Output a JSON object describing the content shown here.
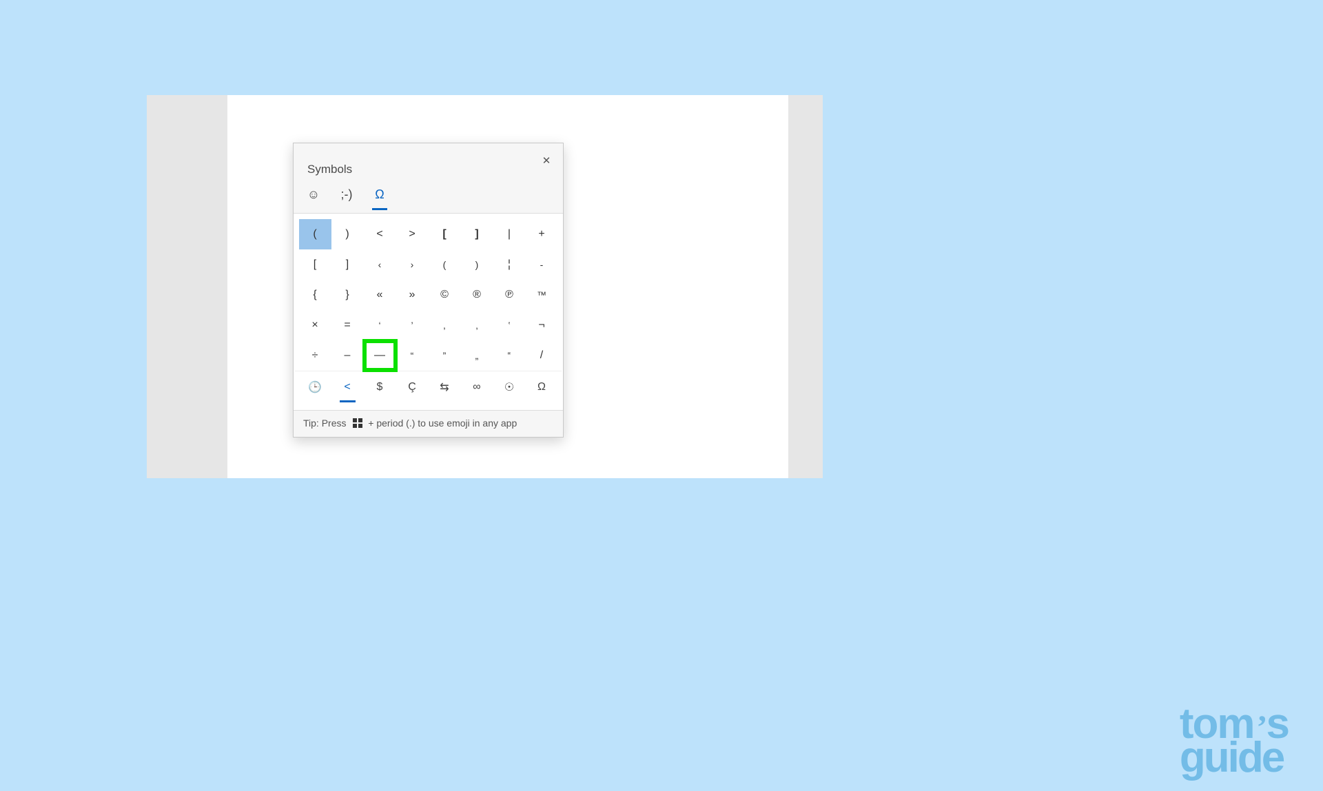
{
  "page_background": "#bde2fb",
  "panel": {
    "title": "Symbols",
    "close_glyph": "✕",
    "tabs": [
      {
        "id": "emoji",
        "glyph": "☺",
        "active": false,
        "name": "tab-emoji"
      },
      {
        "id": "kaomoji",
        "glyph": ";-)",
        "active": false,
        "name": "tab-kaomoji"
      },
      {
        "id": "symbols",
        "glyph": "Ω",
        "active": true,
        "name": "tab-symbols"
      }
    ],
    "grid": [
      [
        {
          "g": "(",
          "state": "selected"
        },
        {
          "g": ")"
        },
        {
          "g": "<"
        },
        {
          "g": ">"
        },
        {
          "g": "[",
          "b": true
        },
        {
          "g": "]",
          "b": true
        },
        {
          "g": "|"
        },
        {
          "g": "+"
        }
      ],
      [
        {
          "g": "["
        },
        {
          "g": "]"
        },
        {
          "g": "‹",
          "sm": true
        },
        {
          "g": "›",
          "sm": true
        },
        {
          "g": "(",
          "sm": true
        },
        {
          "g": ")",
          "sm": true
        },
        {
          "g": "¦"
        },
        {
          "g": "-",
          "sm": true
        }
      ],
      [
        {
          "g": "{"
        },
        {
          "g": "}"
        },
        {
          "g": "«"
        },
        {
          "g": "»"
        },
        {
          "g": "©"
        },
        {
          "g": "®"
        },
        {
          "g": "℗"
        },
        {
          "g": "™",
          "sm": true
        }
      ],
      [
        {
          "g": "×"
        },
        {
          "g": "="
        },
        {
          "g": "‘",
          "sm": true
        },
        {
          "g": "’",
          "sm": true
        },
        {
          "g": ",",
          "sm": true
        },
        {
          "g": "‚",
          "sm": true
        },
        {
          "g": "‛",
          "sm": true
        },
        {
          "g": "¬"
        }
      ],
      [
        {
          "g": "÷"
        },
        {
          "g": "–"
        },
        {
          "g": "—",
          "state": "highlight"
        },
        {
          "g": "“",
          "sm": true
        },
        {
          "g": "”",
          "sm": true
        },
        {
          "g": "„",
          "sm": true
        },
        {
          "g": "‟",
          "sm": true
        },
        {
          "g": "/"
        }
      ]
    ],
    "categories": [
      {
        "glyph": "🕒",
        "name": "cat-recent",
        "active": false
      },
      {
        "glyph": "<",
        "name": "cat-punctuation",
        "active": true
      },
      {
        "glyph": "$",
        "name": "cat-currency",
        "active": false
      },
      {
        "glyph": "Ç",
        "name": "cat-latin",
        "active": false
      },
      {
        "glyph": "⇆",
        "name": "cat-arrows",
        "active": false
      },
      {
        "glyph": "∞",
        "name": "cat-math",
        "active": false
      },
      {
        "glyph": "☉",
        "name": "cat-geometric",
        "active": false
      },
      {
        "glyph": "Ω",
        "name": "cat-language",
        "active": false
      }
    ],
    "tip": {
      "prefix": "Tip: Press",
      "mid": "+ period (.) to use emoji in any app"
    }
  },
  "watermark": {
    "line1_a": "tom",
    "line1_b": "s",
    "line2": "guide"
  }
}
